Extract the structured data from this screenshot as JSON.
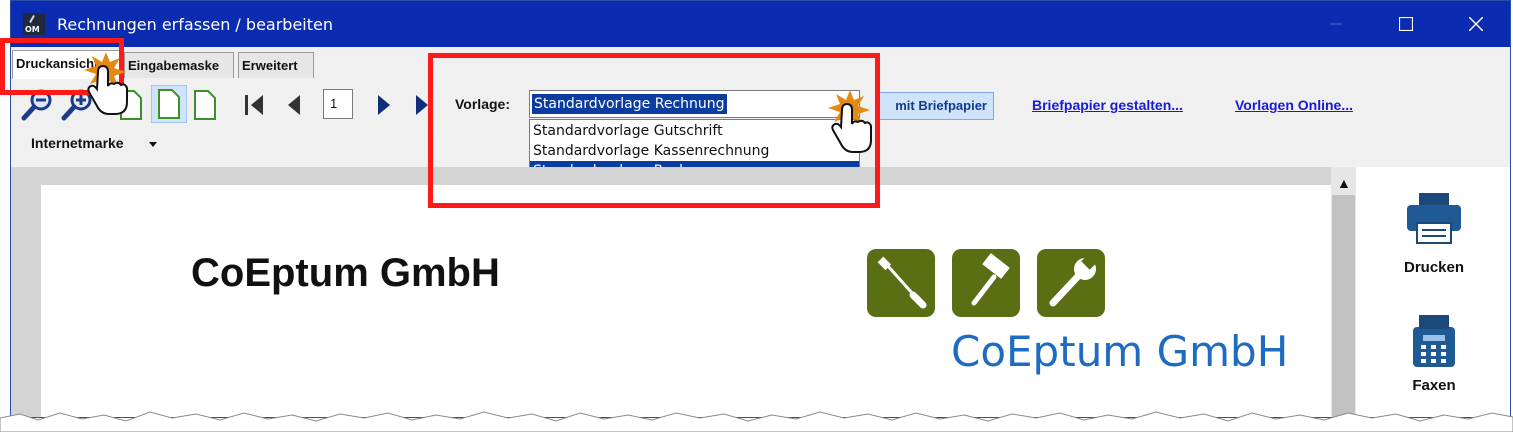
{
  "window": {
    "title": "Rechnungen erfassen / bearbeiten",
    "app_icon_label": "OM"
  },
  "tabs": [
    {
      "label": "Druckansicht",
      "active": true
    },
    {
      "label": "Eingabemaske",
      "active": false
    },
    {
      "label": "Erweitert",
      "active": false
    }
  ],
  "toolbar": {
    "page_number": "1",
    "vorlage_label": "Vorlage:",
    "vorlage_selected": "Standardvorlage Rechnung",
    "vorlage_options": [
      "Standardvorlage Gutschrift",
      "Standardvorlage Kassenrechnung",
      "Standardvorlage Rechnung"
    ],
    "highlighted_option": "Standardvorlage Rechnung",
    "letterhead_button": "mit Briefpapier",
    "design_letterhead_link": "Briefpapier gestalten...",
    "templates_online_link": "Vorlagen Online...",
    "internetmarke_label": "Internetmarke"
  },
  "preview": {
    "company_name": "CoEptum GmbH",
    "logo_text": "CoEptum GmbH",
    "logo_color": "#5a6e13",
    "logo_text_color": "#1e6cc2"
  },
  "side_actions": [
    {
      "label": "Drucken",
      "icon": "printer-icon"
    },
    {
      "label": "Faxen",
      "icon": "fax-icon"
    }
  ],
  "colors": {
    "titlebar": "#0b2bb1",
    "highlight_box": "#ff1a1a",
    "selection": "#0b3c9f"
  }
}
